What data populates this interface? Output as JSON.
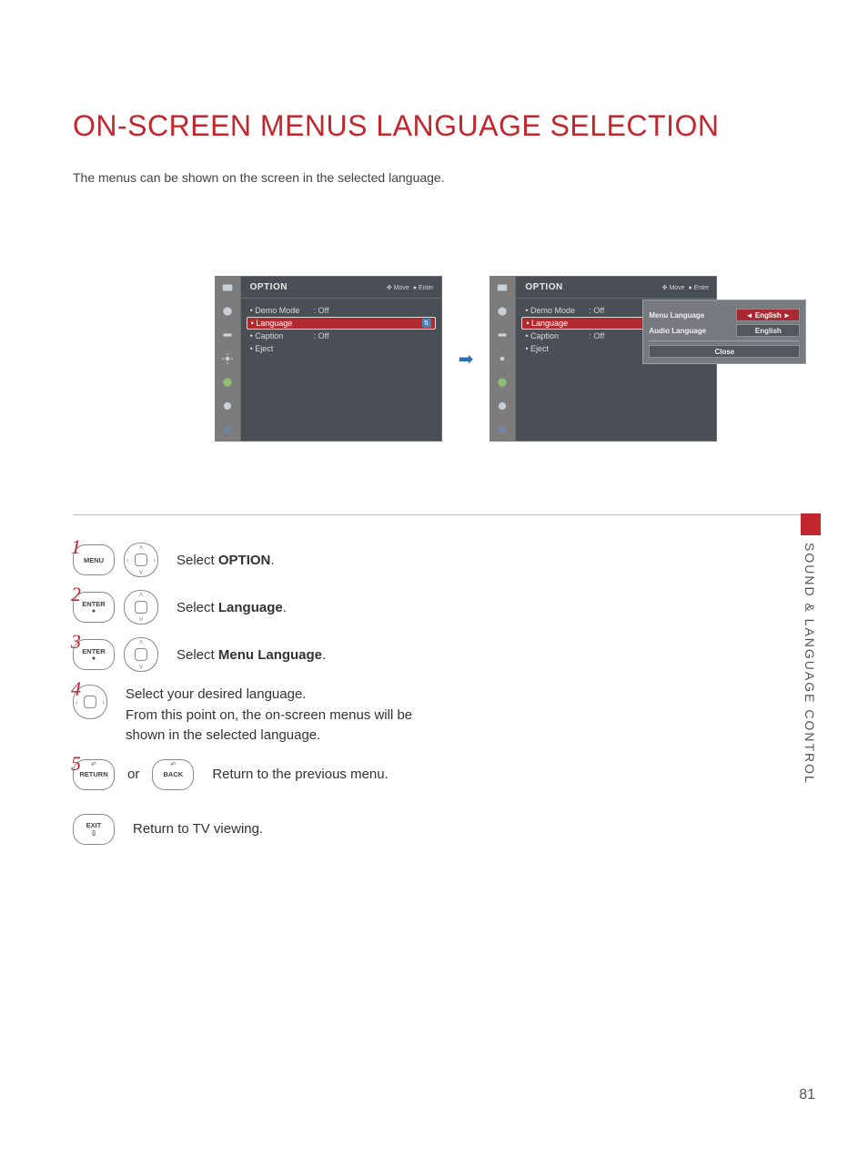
{
  "heading": "ON-SCREEN MENUS LANGUAGE SELECTION",
  "intro": "The menus can be shown on the screen in the selected language.",
  "osd": {
    "title": "OPTION",
    "hint_move": "Move",
    "hint_enter": "Enter",
    "items": [
      {
        "label": "Demo Mode",
        "value": ": Off"
      },
      {
        "label": "Language",
        "value": ""
      },
      {
        "label": "Caption",
        "value": ": Off"
      },
      {
        "label": "Eject",
        "value": ""
      }
    ]
  },
  "popup": {
    "menu_lang_label": "Menu Language",
    "menu_lang_value": "◄ English ►",
    "audio_lang_label": "Audio Language",
    "audio_lang_value": "English",
    "close": "Close"
  },
  "buttons": {
    "menu": "MENU",
    "enter": "ENTER",
    "enter_sym": "●",
    "return": "RETURN",
    "back": "BACK",
    "exit": "EXIT"
  },
  "steps": {
    "s1": "Select OPTION.",
    "s1_pre": "Select ",
    "s1_bold": "OPTION",
    "s1_post": ".",
    "s2_pre": "Select ",
    "s2_bold": "Language",
    "s2_post": ".",
    "s3_pre": "Select ",
    "s3_bold": "Menu Language",
    "s3_post": ".",
    "s4a": "Select your desired language.",
    "s4b": "From this point on, the on-screen menus will be shown in the selected language.",
    "s5": "Return to the previous menu.",
    "s6": "Return to TV viewing.",
    "or": "or"
  },
  "sidelabel": "SOUND & LANGUAGE CONTROL",
  "pagenum": "81"
}
